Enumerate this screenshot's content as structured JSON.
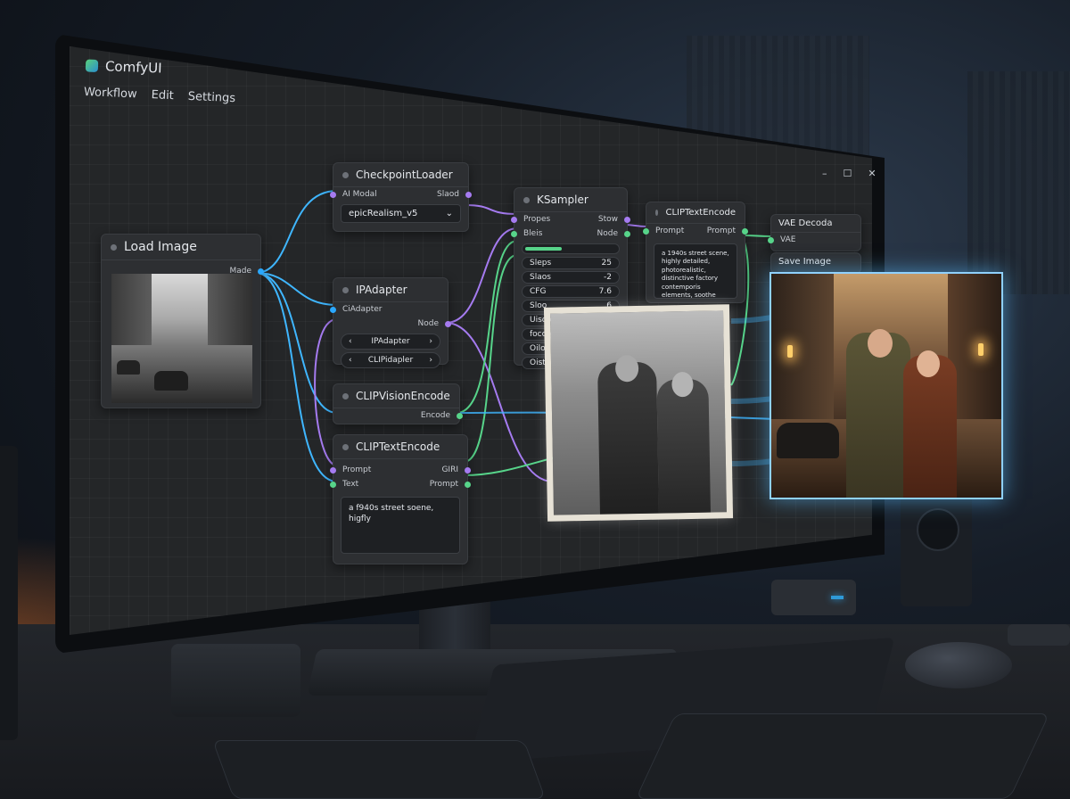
{
  "app": {
    "title": "ComfyUI"
  },
  "menu": [
    "Workflow",
    "Edit",
    "Settings"
  ],
  "window_controls": [
    "–",
    "☐",
    "✕"
  ],
  "nodes": {
    "load_image": {
      "title": "Load Image",
      "output": "Made"
    },
    "checkpoint_loader": {
      "title": "CheckpointLoader",
      "input": "AI Modal",
      "output": "Slaod",
      "model_value": "epicRealism_v5"
    },
    "ip_adapter": {
      "title": "IPAdapter",
      "input": "CiAdapter",
      "output": "Node",
      "widgets": [
        "IPAdapter",
        "CLIPidapler"
      ]
    },
    "clip_vision": {
      "title": "CLIPVisionEncode",
      "output": "Encode"
    },
    "clip_text_1": {
      "title": "CLIPTextEncode",
      "input_1": "Prompt",
      "input_2": "Text",
      "output_1": "GIRI",
      "output_2": "Prompt",
      "text": "a f940s street soene, higfly"
    },
    "ksampler": {
      "title": "KSampler",
      "inputs": [
        "Propes",
        "Bleis"
      ],
      "outputs": [
        "Stow",
        "Node"
      ],
      "widgets": [
        {
          "label": "Sleps",
          "value": "25"
        },
        {
          "label": "Slaos",
          "value": "-2"
        },
        {
          "label": "CFG",
          "value": "7.6"
        },
        {
          "label": "Sloo",
          "value": "6"
        },
        {
          "label": "Uisco",
          "value": ""
        },
        {
          "label": "focco",
          "value": ""
        },
        {
          "label": "Oiloc",
          "value": ""
        },
        {
          "label": "Oisto",
          "value": ""
        }
      ]
    },
    "clip_text_2": {
      "title": "CLIPTextEncode",
      "input": "Prompt",
      "output": "Prompt",
      "text": "a 1940s street scene, highly detailed, photorealistic, distinctive factory contemporis elements, soothe glowing lights."
    },
    "vae_decode": {
      "title": "VAE Decoda",
      "input": "VAE"
    },
    "save_image": {
      "title": "Save Image"
    }
  },
  "colors": {
    "wire_blue": "#3fb6ff",
    "wire_purple": "#a57bf0",
    "wire_green": "#57d48a",
    "glow": "#8fd1ff"
  }
}
